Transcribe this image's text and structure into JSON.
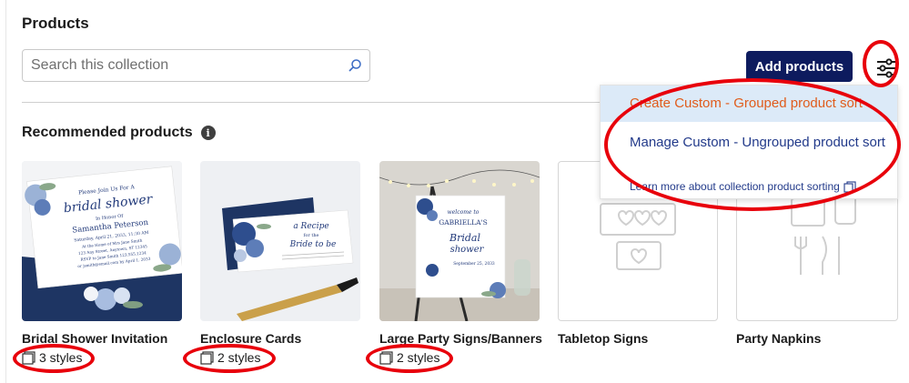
{
  "page": {
    "title": "Products",
    "search": {
      "placeholder": "Search this collection",
      "value": ""
    },
    "add_button": "Add products",
    "filter_icon": "sliders-icon"
  },
  "recommended": {
    "heading": "Recommended products",
    "info_icon": "info-icon",
    "info_glyph": "i",
    "products": [
      {
        "name": "Bridal Shower Invitation",
        "styles": "3 styles"
      },
      {
        "name": "Enclosure Cards",
        "styles": "2 styles"
      },
      {
        "name": "Large Party Signs/Banners",
        "styles": "2 styles"
      },
      {
        "name": "Tabletop Signs",
        "styles": ""
      },
      {
        "name": "Party Napkins",
        "styles": ""
      }
    ]
  },
  "sort_menu": {
    "items": [
      "Create Custom - Grouped product sort",
      "Manage Custom - Ungrouped product sort",
      "Learn more about collection product sorting"
    ]
  },
  "images": {
    "invite_lines": [
      "Please Join Us For A",
      "bridal shower",
      "In Honor Of",
      "Samantha Peterson",
      "Saturday, April 21, 2033, 11:30 AM",
      "At the Home of Mrs Jane Smith",
      "123 Any Street, Anytown, ST 12345",
      "RSVP to Jane Smith 123.555.1234",
      "or jsmith@email.com by April 1, 2033"
    ],
    "enclosure_lines": [
      "a Recipe",
      "for the",
      "Bride to be"
    ],
    "sign_lines": [
      "welcome to",
      "GABRIELLA'S",
      "Bridal",
      "shower",
      "September 25, 2033"
    ]
  },
  "colors": {
    "navy": "#0d1b5e",
    "accent_orange": "#e05c1c",
    "link_blue": "#223a8a",
    "highlight": "#dceaf8",
    "annotation_red": "#e8000b"
  }
}
